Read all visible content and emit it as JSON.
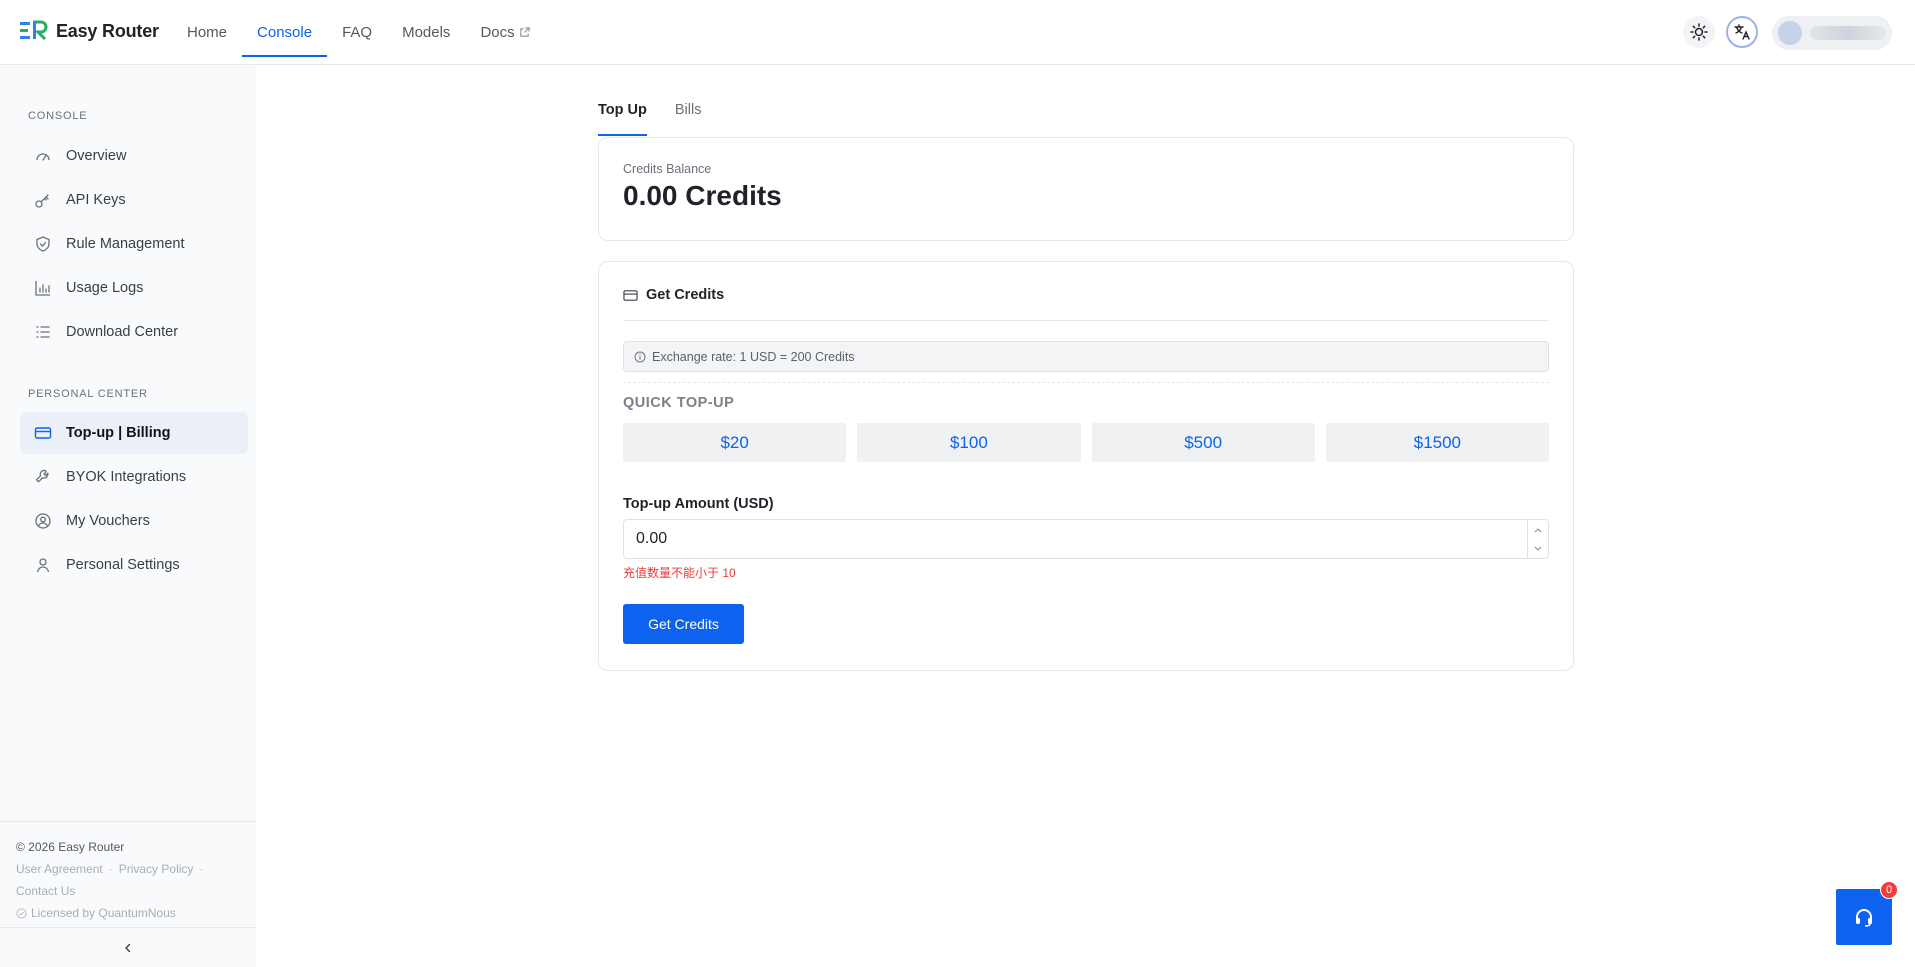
{
  "app": {
    "name": "Easy Router"
  },
  "nav": [
    {
      "label": "Home"
    },
    {
      "label": "Console"
    },
    {
      "label": "FAQ"
    },
    {
      "label": "Models"
    },
    {
      "label": "Docs"
    }
  ],
  "sidebar": {
    "console_section": "CONSOLE",
    "console_items": [
      {
        "label": "Overview"
      },
      {
        "label": "API Keys"
      },
      {
        "label": "Rule Management"
      },
      {
        "label": "Usage Logs"
      },
      {
        "label": "Download Center"
      }
    ],
    "personal_section": "PERSONAL CENTER",
    "personal_items": [
      {
        "label": "Top-up | Billing"
      },
      {
        "label": "BYOK Integrations"
      },
      {
        "label": "My Vouchers"
      },
      {
        "label": "Personal Settings"
      }
    ],
    "footer": {
      "copyright": "© 2026 Easy Router",
      "user_agreement": "User Agreement",
      "privacy_policy": "Privacy Policy",
      "contact_us": "Contact Us",
      "licensed": "Licensed by QuantumNous"
    }
  },
  "tabs": [
    {
      "label": "Top Up"
    },
    {
      "label": "Bills"
    }
  ],
  "balance": {
    "label": "Credits Balance",
    "value": "0.00 Credits"
  },
  "get_credits": {
    "title": "Get Credits",
    "exchange_rate": "Exchange rate: 1 USD = 200 Credits",
    "quick_title": "QUICK TOP-UP",
    "quick_amounts": [
      "$20",
      "$100",
      "$500",
      "$1500"
    ],
    "amount_label": "Top-up Amount (USD)",
    "amount_value": "0.00",
    "error": "充值数量不能小于 10",
    "submit_label": "Get Credits"
  },
  "support": {
    "badge": "0"
  },
  "colors": {
    "accent": "#0d62f0",
    "error": "#f03a3a",
    "sidebar_bg": "#f9fafb"
  }
}
